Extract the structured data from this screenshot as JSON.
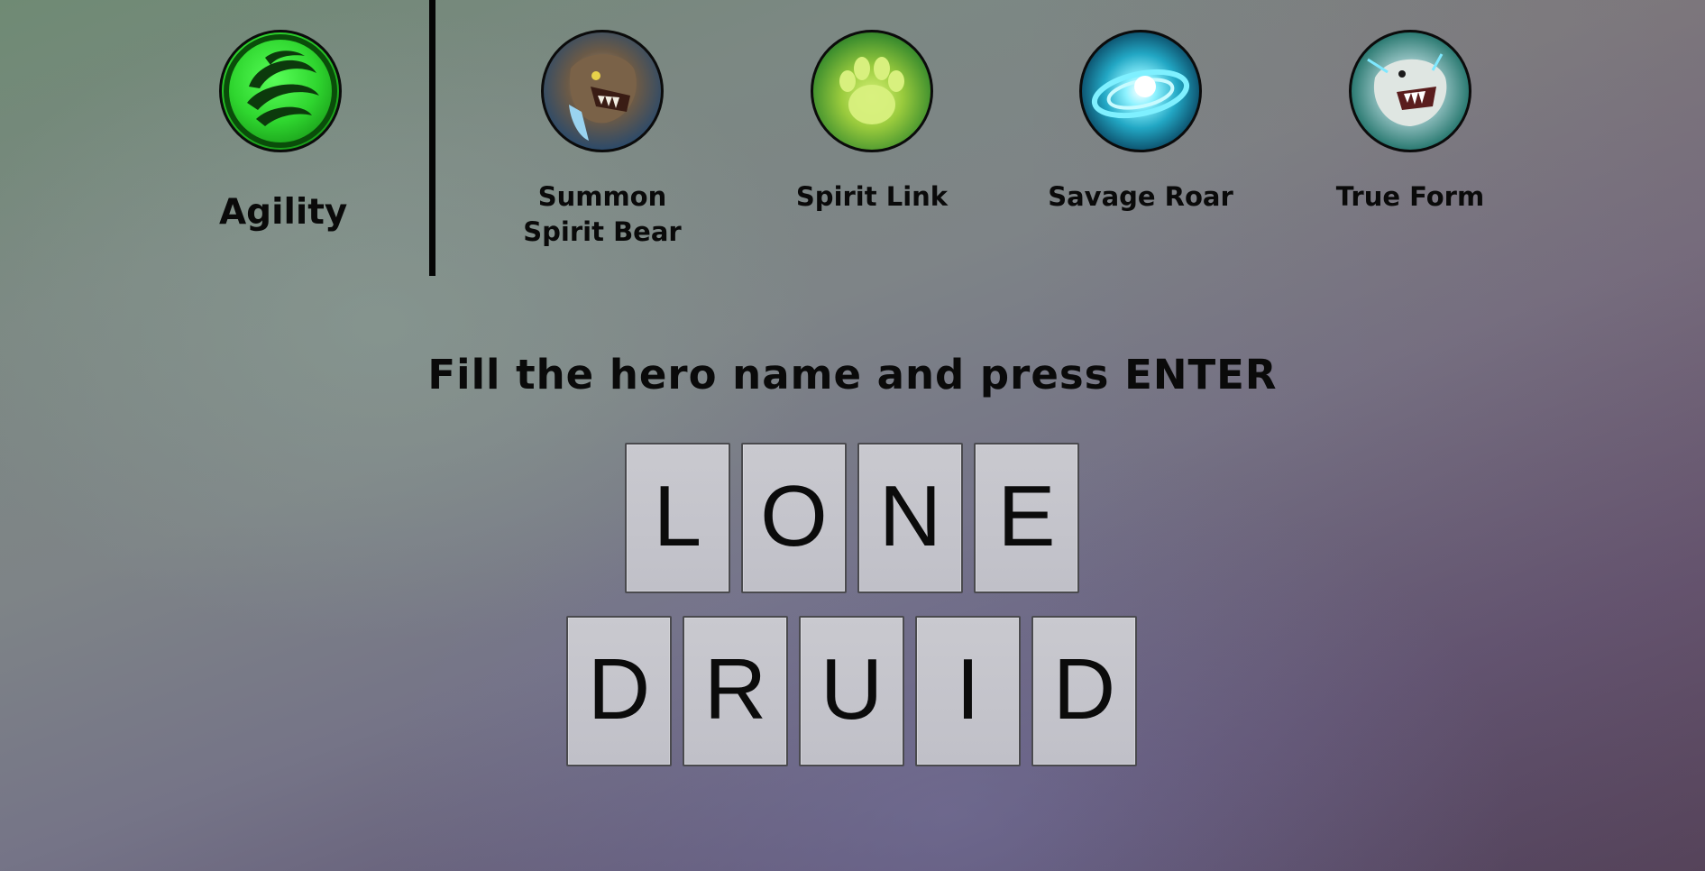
{
  "attribute": {
    "label": "Agility",
    "icon": "agility-icon",
    "color": "#2fd62f"
  },
  "abilities": [
    {
      "label": "Summon Spirit Bear",
      "icon": "spirit-bear-icon"
    },
    {
      "label": "Spirit Link",
      "icon": "spirit-link-icon"
    },
    {
      "label": "Savage Roar",
      "icon": "savage-roar-icon"
    },
    {
      "label": "True Form",
      "icon": "true-form-icon"
    }
  ],
  "prompt": "Fill the hero name and press ENTER",
  "answer": {
    "words": [
      {
        "letters": [
          "L",
          "O",
          "N",
          "E"
        ]
      },
      {
        "letters": [
          "D",
          "R",
          "U",
          "I",
          "D"
        ]
      }
    ]
  }
}
